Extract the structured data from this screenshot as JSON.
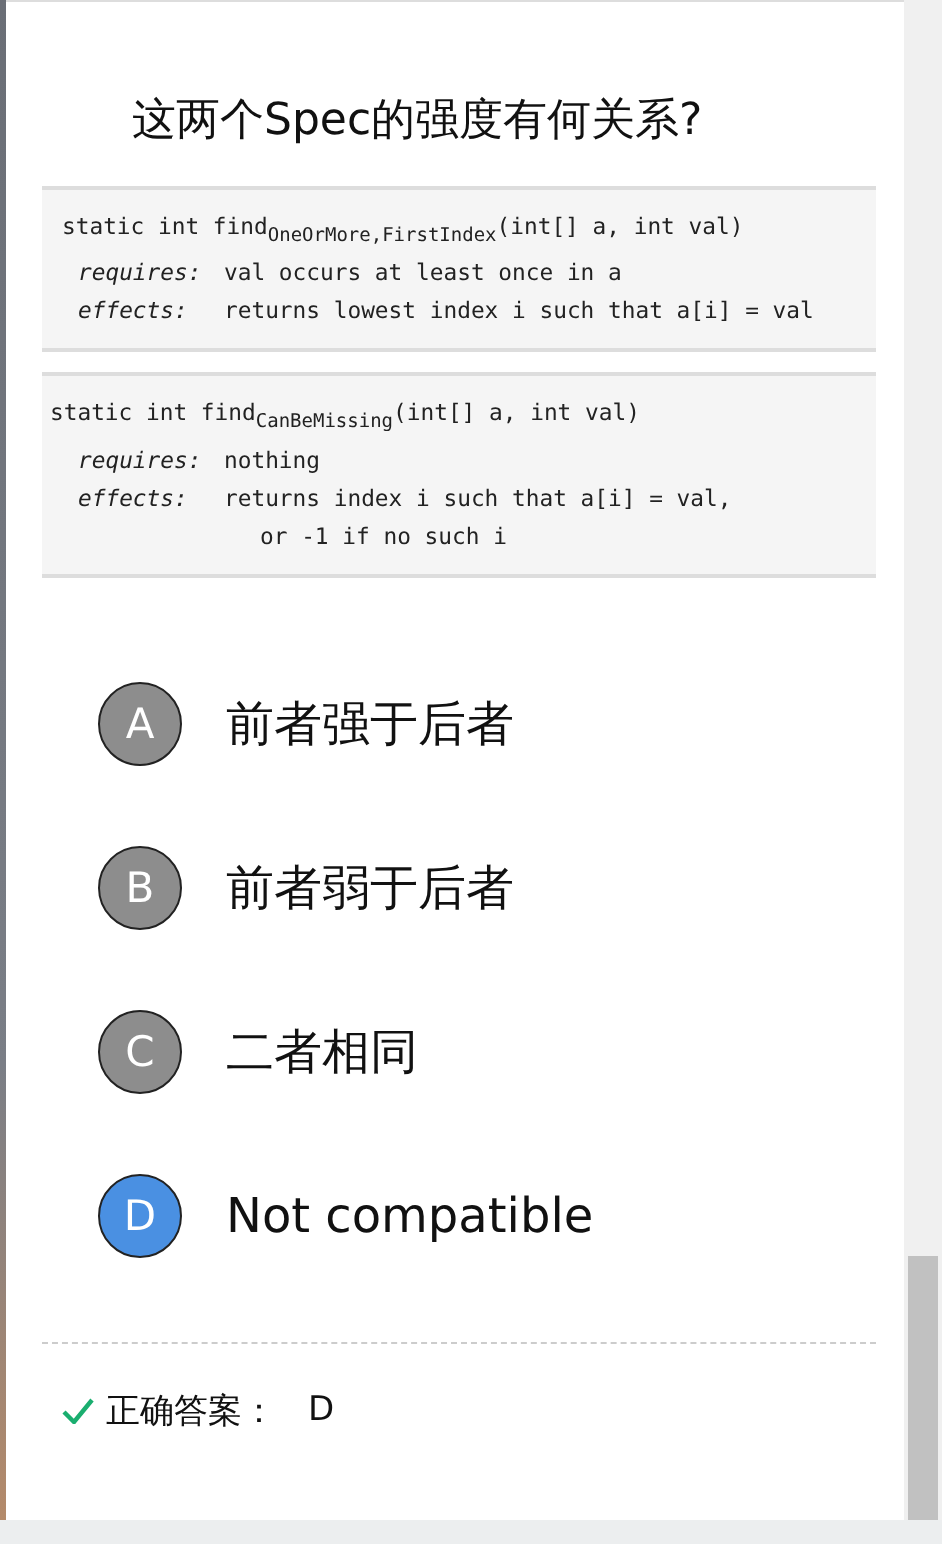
{
  "question": {
    "title": "这两个Spec的强度有何关系?"
  },
  "code_blocks": [
    {
      "lines": [
        {
          "kind": "signature",
          "text": "static int find$_{OneOrMore,FirstIndex}$(int[] a, int val)"
        },
        {
          "kind": "clause",
          "label": "requires:",
          "text": "val occurs at least once in a"
        },
        {
          "kind": "clause",
          "label": "effects:",
          "text": "returns lowest index i such that a[i] = val"
        }
      ]
    },
    {
      "lines": [
        {
          "kind": "signature",
          "text": "static int find$_{CanBeMissing}$(int[] a, int val)"
        },
        {
          "kind": "clause",
          "label": "requires:",
          "text": "nothing"
        },
        {
          "kind": "clause",
          "label": "effects:",
          "text": "returns index i such that a[i] = val,"
        },
        {
          "kind": "continuation",
          "text": "or -1 if no such i"
        }
      ]
    }
  ],
  "options": [
    {
      "letter": "A",
      "text": "前者强于后者",
      "selected": false
    },
    {
      "letter": "B",
      "text": "前者弱于后者",
      "selected": false
    },
    {
      "letter": "C",
      "text": "二者相同",
      "selected": false
    },
    {
      "letter": "D",
      "text": "Not compatible",
      "selected": true
    }
  ],
  "answer": {
    "label": "正确答案：",
    "value": "D"
  }
}
